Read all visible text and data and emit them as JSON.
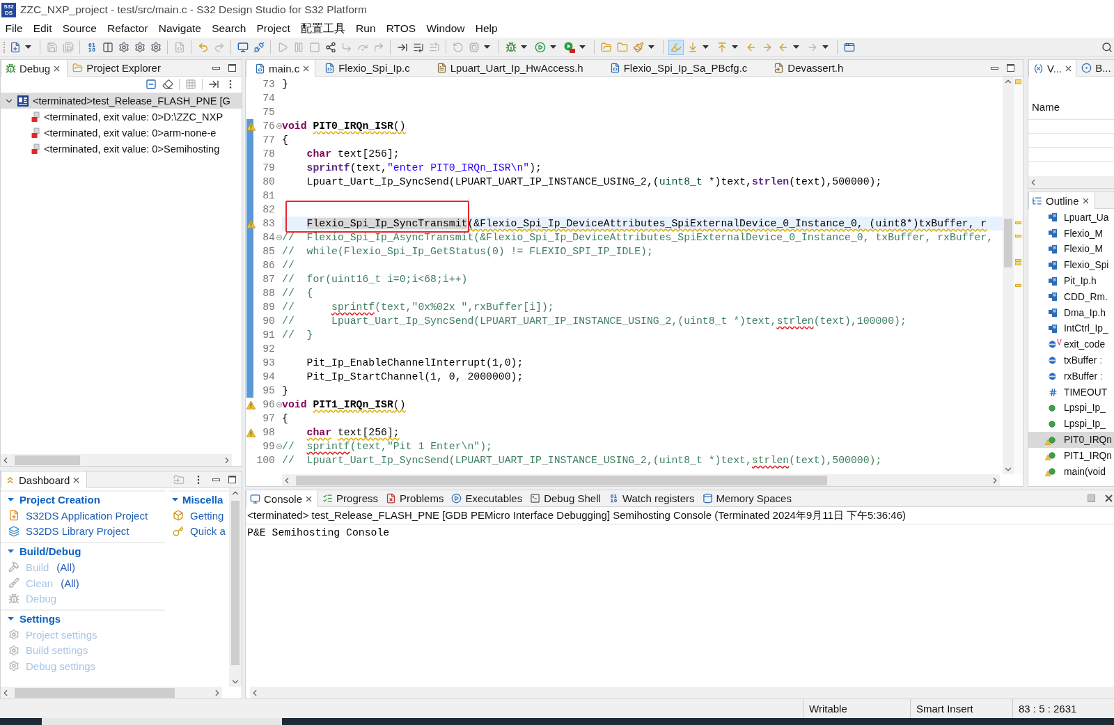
{
  "window": {
    "logo_lines": [
      "S32",
      "DS"
    ],
    "title": "ZZC_NXP_project - test/src/main.c - S32 Design Studio for S32 Platform"
  },
  "menu": [
    "File",
    "Edit",
    "Source",
    "Refactor",
    "Navigate",
    "Search",
    "Project",
    "配置工具",
    "Run",
    "RTOS",
    "Window",
    "Help"
  ],
  "toolbar": {
    "groups": [
      {
        "items": [
          {
            "disabled": false,
            "pressed": false
          }
        ]
      },
      {
        "items": [
          {
            "disabled": true,
            "pressed": false
          },
          {
            "disabled": true,
            "pressed": false
          }
        ]
      },
      {
        "items": [
          {
            "disabled": false,
            "pressed": false
          },
          {
            "disabled": false,
            "pressed": false
          },
          {
            "disabled": false,
            "pressed": false
          },
          {
            "disabled": false,
            "pressed": false
          },
          {
            "disabled": false,
            "pressed": false
          }
        ]
      },
      {
        "items": [
          {
            "disabled": true,
            "pressed": false
          }
        ]
      },
      {
        "items": [
          {
            "disabled": false,
            "pressed": false
          },
          {
            "disabled": true,
            "pressed": false
          }
        ]
      },
      {
        "items": [
          {
            "disabled": false,
            "pressed": false
          },
          {
            "disabled": false,
            "pressed": false
          }
        ]
      },
      {
        "items": [
          {
            "disabled": true,
            "pressed": false
          },
          {
            "disabled": true,
            "pressed": false
          },
          {
            "disabled": true,
            "pressed": false
          },
          {
            "disabled": false,
            "pressed": false
          },
          {
            "disabled": true,
            "pressed": false
          },
          {
            "disabled": true,
            "pressed": false
          },
          {
            "disabled": true,
            "pressed": false
          }
        ]
      },
      {
        "items": [
          {
            "disabled": false,
            "pressed": false
          },
          {
            "disabled": false,
            "pressed": false
          },
          {
            "disabled": true,
            "pressed": false
          }
        ]
      },
      {
        "items": [
          {
            "disabled": true,
            "pressed": false
          },
          {
            "disabled": true,
            "pressed": false
          }
        ]
      },
      {
        "items": [
          {
            "disabled": false,
            "pressed": false
          },
          {
            "disabled": false,
            "pressed": false
          },
          {
            "disabled": false,
            "pressed": false
          }
        ]
      },
      {
        "items": [
          {
            "disabled": false,
            "pressed": false
          },
          {
            "disabled": false,
            "pressed": false
          },
          {
            "disabled": false,
            "pressed": false
          }
        ]
      },
      {
        "items": [
          {
            "disabled": false,
            "pressed": true
          },
          {
            "disabled": false,
            "pressed": false
          },
          {
            "disabled": false,
            "pressed": false
          },
          {
            "disabled": false,
            "pressed": false
          },
          {
            "disabled": false,
            "pressed": false
          },
          {
            "disabled": false,
            "pressed": false
          },
          {
            "disabled": true,
            "pressed": false
          }
        ]
      },
      {
        "items": [
          {
            "disabled": false,
            "pressed": false
          }
        ]
      }
    ]
  },
  "debug_panel": {
    "tabs": [
      {
        "kind": "debug",
        "label": "Debug",
        "selected": true
      },
      {
        "kind": "explorer",
        "label": "Project Explorer",
        "selected": false
      }
    ],
    "tree": [
      {
        "label": "<terminated>test_Release_FLASH_PNE [G",
        "expanded": true,
        "selected": true,
        "children": [
          {
            "label": "<terminated, exit value: 0>D:\\ZZC_NXP",
            "selected": false
          },
          {
            "label": "<terminated, exit value: 0>arm-none-e",
            "selected": false
          },
          {
            "label": "<terminated, exit value: 0>Semihosting",
            "selected": false
          }
        ]
      }
    ]
  },
  "dashboard": {
    "tab": {
      "kind": "dashboard",
      "label": "Dashboard",
      "selected": true
    },
    "columns": [
      [
        {
          "title": "Project Creation",
          "expanded": true,
          "items": [
            {
              "label": "S32DS Application Project",
              "disabled": false
            },
            {
              "label": "S32DS Library Project",
              "disabled": false
            }
          ]
        },
        {
          "title": "Build/Debug",
          "expanded": true,
          "items": [
            {
              "label": "Build",
              "link": "(All)",
              "disabled": true
            },
            {
              "label": "Clean",
              "link": "(All)",
              "disabled": true
            },
            {
              "label": "Debug",
              "disabled": true
            }
          ]
        },
        {
          "title": "Settings",
          "expanded": true,
          "items": [
            {
              "label": "Project settings",
              "disabled": true
            },
            {
              "label": "Build settings",
              "disabled": true
            },
            {
              "label": "Debug settings",
              "disabled": true
            }
          ]
        }
      ],
      [
        {
          "title": "Miscella",
          "expanded": true,
          "items": [
            {
              "label": "Getting",
              "disabled": false
            },
            {
              "label": "Quick a",
              "disabled": false
            }
          ]
        }
      ]
    ]
  },
  "editor": {
    "tabs": [
      {
        "kind": "source",
        "label": "main.c",
        "selected": true
      },
      {
        "kind": "source",
        "label": "Flexio_Spi_Ip.c",
        "selected": false
      },
      {
        "kind": "header",
        "label": "Lpuart_Uart_Ip_HwAccess.h",
        "selected": false
      },
      {
        "kind": "source",
        "label": "Flexio_Spi_Ip_Sa_PBcfg.c",
        "selected": false
      },
      {
        "kind": "linked",
        "label": "Devassert.h",
        "selected": false
      }
    ],
    "lines": [
      {
        "number": "73",
        "warning": false,
        "fold": false,
        "in_range": false,
        "current": false,
        "tokens": [
          {
            "kind": "plain",
            "text": "}"
          }
        ]
      },
      {
        "number": "74",
        "warning": false,
        "fold": false,
        "in_range": false,
        "current": false
      },
      {
        "number": "75",
        "warning": false,
        "fold": false,
        "in_range": false,
        "current": false
      },
      {
        "number": "76",
        "warning": true,
        "fold": true,
        "in_range": true,
        "current": false,
        "tokens": [
          {
            "kind": "keyword",
            "text": "void"
          },
          {
            "kind": "declaration",
            "text": " PIT0_IRQn_ISR",
            "warning": true
          },
          {
            "kind": "plain",
            "text": "()",
            "warning": true
          }
        ]
      },
      {
        "number": "77",
        "warning": false,
        "fold": false,
        "in_range": true,
        "current": false,
        "tokens": [
          {
            "kind": "plain",
            "text": "{"
          }
        ]
      },
      {
        "number": "78",
        "warning": false,
        "fold": false,
        "in_range": true,
        "current": false,
        "tokens": [
          {
            "kind": "keyword",
            "text": "    char"
          },
          {
            "kind": "plain",
            "text": " text[256];"
          }
        ]
      },
      {
        "number": "79",
        "warning": false,
        "fold": false,
        "in_range": true,
        "current": false,
        "tokens": [
          {
            "kind": "builtin",
            "text": "    sprintf"
          },
          {
            "kind": "plain",
            "text": "(text,"
          },
          {
            "kind": "string",
            "text": "\"enter PIT0_IRQn_ISR\\n\""
          },
          {
            "kind": "plain",
            "text": ");"
          }
        ]
      },
      {
        "number": "80",
        "warning": false,
        "fold": false,
        "in_range": true,
        "current": false,
        "tokens": [
          {
            "kind": "plain",
            "text": "    Lpuart_Uart_Ip_SyncSend(LPUART_UART_IP_INSTANCE_USING_2,("
          },
          {
            "kind": "type",
            "text": "uint8_t"
          },
          {
            "kind": "plain",
            "text": " *)text,"
          },
          {
            "kind": "builtin",
            "text": "strlen"
          },
          {
            "kind": "plain",
            "text": "(text),500000);"
          }
        ]
      },
      {
        "number": "81",
        "warning": false,
        "fold": false,
        "in_range": true,
        "current": false
      },
      {
        "number": "82",
        "warning": false,
        "fold": false,
        "in_range": true,
        "current": false
      },
      {
        "number": "83",
        "warning": true,
        "fold": false,
        "in_range": true,
        "current": true,
        "tokens": [
          {
            "kind": "occurrence",
            "text": "    Flexio_Spi_Ip_SyncTransmit",
            "boxed": true
          },
          {
            "kind": "plain",
            "text": "(&Flexio_Spi_Ip_DeviceAttributes_SpiExternalDevice_0_Instance_0, (uint8*)txBuffer, r",
            "warning": true
          }
        ]
      },
      {
        "number": "84",
        "warning": false,
        "fold": true,
        "in_range": true,
        "current": false,
        "tokens": [
          {
            "kind": "comment",
            "text": "//  Flexio_Spi_Ip_AsyncTransmit(&Flexio_Spi_Ip_DeviceAttributes_SpiExternalDevice_0_Instance_0, txBuffer, rxBuffer,"
          }
        ]
      },
      {
        "number": "85",
        "warning": false,
        "fold": false,
        "in_range": true,
        "current": false,
        "tokens": [
          {
            "kind": "comment",
            "text": "//  while(Flexio_Spi_Ip_GetStatus(0) != FLEXIO_SPI_IP_IDLE);"
          }
        ]
      },
      {
        "number": "86",
        "warning": false,
        "fold": false,
        "in_range": true,
        "current": false,
        "tokens": [
          {
            "kind": "comment",
            "text": "//"
          }
        ]
      },
      {
        "number": "87",
        "warning": false,
        "fold": false,
        "in_range": true,
        "current": false,
        "tokens": [
          {
            "kind": "comment",
            "text": "//  for(uint16_t i=0;i<68;i++)"
          }
        ]
      },
      {
        "number": "88",
        "warning": false,
        "fold": false,
        "in_range": true,
        "current": false,
        "tokens": [
          {
            "kind": "comment",
            "text": "//  {"
          }
        ]
      },
      {
        "number": "89",
        "warning": false,
        "fold": false,
        "in_range": true,
        "current": false,
        "tokens": [
          {
            "kind": "comment",
            "text": "//      "
          },
          {
            "kind": "comment",
            "text": "sprintf",
            "error": true
          },
          {
            "kind": "comment",
            "text": "(text,\"0x%02x \",rxBuffer[i]);"
          }
        ]
      },
      {
        "number": "90",
        "warning": false,
        "fold": false,
        "in_range": true,
        "current": false,
        "tokens": [
          {
            "kind": "comment",
            "text": "//      Lpuart_Uart_Ip_SyncSend(LPUART_UART_IP_INSTANCE_USING_2,(uint8_t *)text,"
          },
          {
            "kind": "comment",
            "text": "strlen",
            "error": true
          },
          {
            "kind": "comment",
            "text": "(text),100000);"
          }
        ]
      },
      {
        "number": "91",
        "warning": false,
        "fold": false,
        "in_range": true,
        "current": false,
        "tokens": [
          {
            "kind": "comment",
            "text": "//  }"
          }
        ]
      },
      {
        "number": "92",
        "warning": false,
        "fold": false,
        "in_range": true,
        "current": false
      },
      {
        "number": "93",
        "warning": false,
        "fold": false,
        "in_range": true,
        "current": false,
        "tokens": [
          {
            "kind": "plain",
            "text": "    Pit_Ip_EnableChannelInterrupt(1,0);"
          }
        ]
      },
      {
        "number": "94",
        "warning": false,
        "fold": false,
        "in_range": true,
        "current": false,
        "tokens": [
          {
            "kind": "plain",
            "text": "    Pit_Ip_StartChannel(1, 0, 2000000);"
          }
        ]
      },
      {
        "number": "95",
        "warning": false,
        "fold": false,
        "in_range": true,
        "current": false,
        "tokens": [
          {
            "kind": "plain",
            "text": "}"
          }
        ]
      },
      {
        "number": "96",
        "warning": true,
        "fold": true,
        "in_range": false,
        "current": false,
        "tokens": [
          {
            "kind": "keyword",
            "text": "void"
          },
          {
            "kind": "declaration",
            "text": " PIT1_IRQn_ISR",
            "warning": true
          },
          {
            "kind": "plain",
            "text": "()",
            "warning": true
          }
        ]
      },
      {
        "number": "97",
        "warning": false,
        "fold": false,
        "in_range": false,
        "current": false,
        "tokens": [
          {
            "kind": "plain",
            "text": "{"
          }
        ]
      },
      {
        "number": "98",
        "warning": true,
        "fold": false,
        "in_range": false,
        "current": false,
        "tokens": [
          {
            "kind": "keyword",
            "text": "    char",
            "warning": true
          },
          {
            "kind": "plain",
            "text": " text[256];",
            "warning": true
          }
        ]
      },
      {
        "number": "99",
        "warning": false,
        "fold": true,
        "in_range": false,
        "current": false,
        "tokens": [
          {
            "kind": "comment",
            "text": "//  "
          },
          {
            "kind": "comment",
            "text": "sprintf",
            "error": true
          },
          {
            "kind": "comment",
            "text": "(text,\"Pit 1 Enter\\n\");"
          }
        ]
      },
      {
        "number": "100",
        "warning": false,
        "fold": false,
        "in_range": false,
        "current": false,
        "tokens": [
          {
            "kind": "comment",
            "text": "//  Lpuart_Uart_Ip_SyncSend(LPUART_UART_IP_INSTANCE_USING_2,(uint8_t *)text,"
          },
          {
            "kind": "comment",
            "text": "strlen",
            "error": true
          },
          {
            "kind": "comment",
            "text": "(text),500000);"
          }
        ]
      }
    ]
  },
  "variables_panel": {
    "tabs": [
      {
        "kind": "variables",
        "label": "V...",
        "selected": true
      },
      {
        "kind": "breakpoints",
        "label": "B...",
        "selected": false
      }
    ],
    "columns": [
      "Name"
    ]
  },
  "outline": {
    "tab": {
      "kind": "outline",
      "label": "Outline",
      "selected": true
    },
    "items": [
      {
        "kind": "include",
        "label": "Lpuart_Ua",
        "selected": false,
        "warning": false
      },
      {
        "kind": "include",
        "label": "Flexio_M",
        "selected": false,
        "warning": false
      },
      {
        "kind": "include",
        "label": "Flexio_M",
        "selected": false,
        "warning": false
      },
      {
        "kind": "include",
        "label": "Flexio_Spi",
        "selected": false,
        "warning": false
      },
      {
        "kind": "include",
        "label": "Pit_Ip.h",
        "selected": false,
        "warning": false
      },
      {
        "kind": "include",
        "label": "CDD_Rm.",
        "selected": false,
        "warning": false
      },
      {
        "kind": "include",
        "label": "Dma_Ip.h",
        "selected": false,
        "warning": false
      },
      {
        "kind": "include",
        "label": "IntCtrl_Ip_",
        "selected": false,
        "warning": false
      },
      {
        "kind": "variable",
        "label": "exit_code",
        "badge": "V",
        "selected": false,
        "warning": false
      },
      {
        "kind": "variable",
        "label": "txBuffer",
        "type": ":",
        "selected": false,
        "warning": false
      },
      {
        "kind": "variable",
        "label": "rxBuffer",
        "type": ":",
        "selected": false,
        "warning": false
      },
      {
        "kind": "macro",
        "label": "TIMEOUT",
        "selected": false,
        "warning": false
      },
      {
        "kind": "function",
        "label": "Lpspi_Ip_",
        "selected": false,
        "warning": false
      },
      {
        "kind": "function",
        "label": "Lpspi_Ip_",
        "selected": false,
        "warning": false
      },
      {
        "kind": "function",
        "label": "PIT0_IRQn",
        "selected": true,
        "warning": true
      },
      {
        "kind": "function",
        "label": "PIT1_IRQn",
        "selected": false,
        "warning": true
      },
      {
        "kind": "function",
        "label": "main(void",
        "selected": false,
        "warning": true
      }
    ]
  },
  "console": {
    "tabs": [
      {
        "kind": "console",
        "label": "Console",
        "selected": true
      },
      {
        "kind": "progress",
        "label": "Progress",
        "selected": false
      },
      {
        "kind": "problems",
        "label": "Problems",
        "selected": false
      },
      {
        "kind": "executables",
        "label": "Executables",
        "selected": false
      },
      {
        "kind": "shell",
        "label": "Debug Shell",
        "selected": false
      },
      {
        "kind": "registers",
        "label": "Watch registers",
        "selected": false
      },
      {
        "kind": "memory",
        "label": "Memory Spaces",
        "selected": false
      }
    ],
    "header": "<terminated> test_Release_FLASH_PNE [GDB PEMicro Interface Debugging] Semihosting Console (Terminated 2024年9月11日 下午5:36:46)",
    "lines": [
      "P&E Semihosting Console"
    ]
  },
  "status_bar": [
    "Writable",
    "Smart Insert",
    "83 : 5 : 2631"
  ]
}
